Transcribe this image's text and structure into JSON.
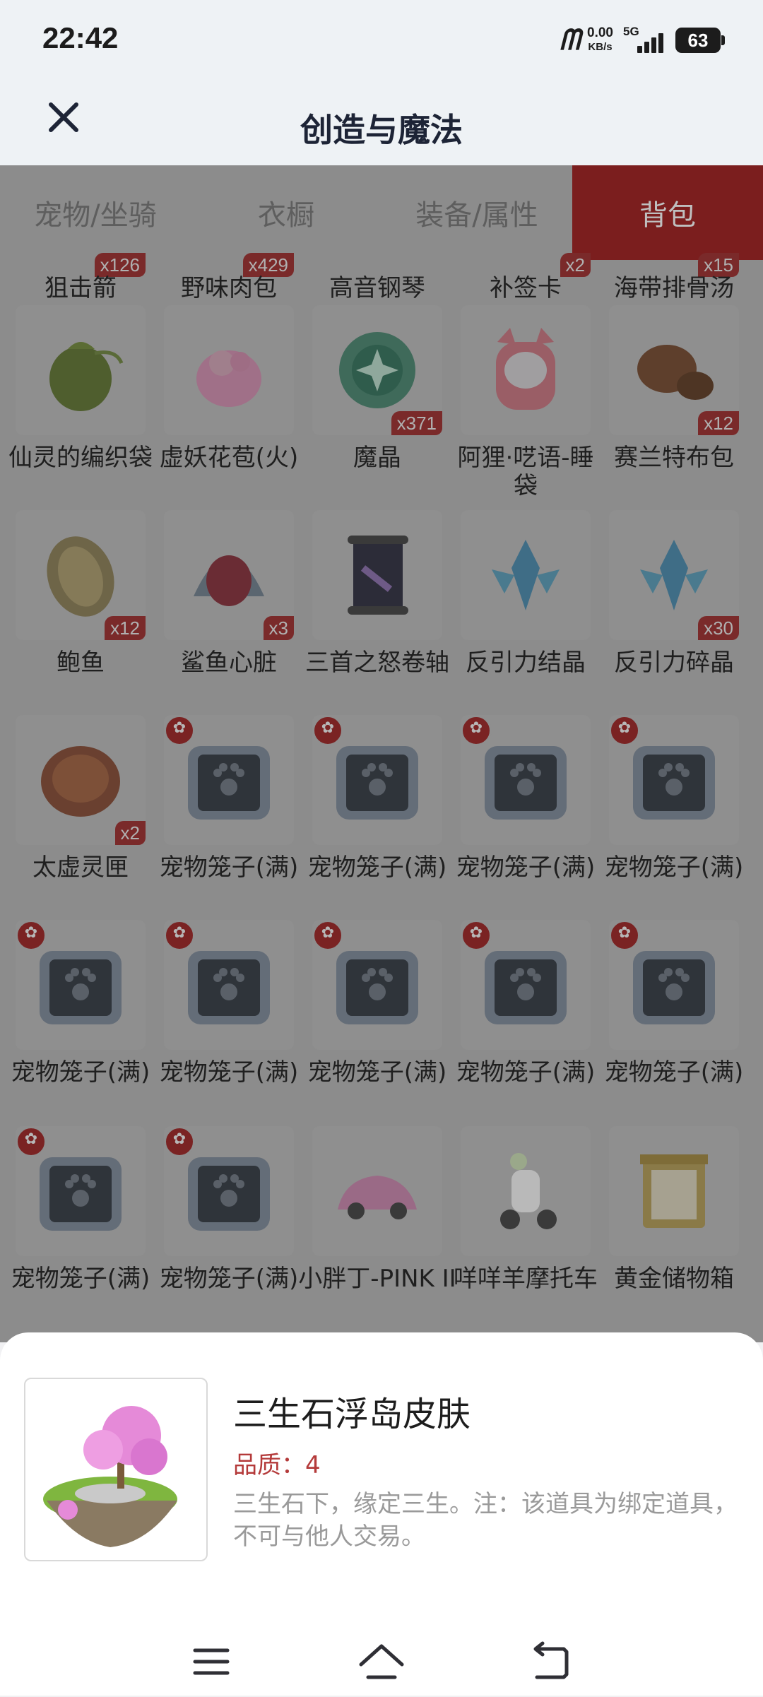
{
  "status_bar": {
    "time": "22:42",
    "net_speed_value": "0.00",
    "net_speed_unit": "KB/s",
    "network": "5G",
    "battery": "63"
  },
  "header": {
    "title": "创造与魔法",
    "close_icon": "close-icon"
  },
  "tabs": [
    {
      "label": "宠物/坐骑",
      "active": false
    },
    {
      "label": "衣橱",
      "active": false
    },
    {
      "label": "装备/属性",
      "active": false
    },
    {
      "label": "背包",
      "active": true
    }
  ],
  "inventory": {
    "partial_row": [
      {
        "name": "狙击箭",
        "count": "x126"
      },
      {
        "name": "野味肉包",
        "count": "x429"
      },
      {
        "name": "高音钢琴",
        "count": ""
      },
      {
        "name": "补签卡",
        "count": "x2"
      },
      {
        "name": "海带排骨汤",
        "count": "x15"
      }
    ],
    "rows": [
      [
        {
          "name": "仙灵的编织袋",
          "count": "",
          "icon": "green-pouch-icon"
        },
        {
          "name": "虚妖花苞(火)",
          "count": "",
          "icon": "pink-flower-bud-icon"
        },
        {
          "name": "魔晶",
          "count": "x371",
          "icon": "green-crystal-icon"
        },
        {
          "name": "阿狸·呓语-睡袋",
          "count": "",
          "icon": "fox-sleeping-bag-icon"
        },
        {
          "name": "赛兰特布包",
          "count": "x12",
          "icon": "leather-pouch-icon"
        }
      ],
      [
        {
          "name": "鲍鱼",
          "count": "x12",
          "icon": "abalone-icon"
        },
        {
          "name": "鲨鱼心脏",
          "count": "x3",
          "icon": "shark-heart-icon"
        },
        {
          "name": "三首之怒卷轴",
          "count": "",
          "icon": "scroll-icon"
        },
        {
          "name": "反引力结晶",
          "count": "",
          "icon": "antigravity-crystal-icon"
        },
        {
          "name": "反引力碎晶",
          "count": "x30",
          "icon": "antigravity-shard-icon"
        }
      ],
      [
        {
          "name": "太虚灵匣",
          "count": "x2",
          "icon": "spirit-box-icon"
        },
        {
          "name": "宠物笼子(满)",
          "count": "",
          "icon": "pet-cage-icon"
        },
        {
          "name": "宠物笼子(满)",
          "count": "",
          "icon": "pet-cage-icon"
        },
        {
          "name": "宠物笼子(满)",
          "count": "",
          "icon": "pet-cage-icon"
        },
        {
          "name": "宠物笼子(满)",
          "count": "",
          "icon": "pet-cage-icon"
        }
      ],
      [
        {
          "name": "宠物笼子(满)",
          "count": "",
          "icon": "pet-cage-icon"
        },
        {
          "name": "宠物笼子(满)",
          "count": "",
          "icon": "pet-cage-icon"
        },
        {
          "name": "宠物笼子(满)",
          "count": "",
          "icon": "pet-cage-icon"
        },
        {
          "name": "宠物笼子(满)",
          "count": "",
          "icon": "pet-cage-icon"
        },
        {
          "name": "宠物笼子(满)",
          "count": "",
          "icon": "pet-cage-icon"
        }
      ],
      [
        {
          "name": "宠物笼子(满)",
          "count": "",
          "icon": "pet-cage-icon"
        },
        {
          "name": "宠物笼子(满)",
          "count": "",
          "icon": "pet-cage-icon"
        },
        {
          "name": "小胖丁-PINK II",
          "count": "",
          "icon": "pink-car-icon"
        },
        {
          "name": "咩咩羊摩托车",
          "count": "",
          "icon": "sheep-scooter-icon"
        },
        {
          "name": "黄金储物箱",
          "count": "",
          "icon": "gold-storage-box-icon"
        }
      ]
    ]
  },
  "detail": {
    "name": "三生石浮岛皮肤",
    "quality": "品质：4",
    "description": "三生石下，缘定三生。注：该道具为绑定道具，不可与他人交易。",
    "icon": "floating-island-icon"
  },
  "nav": {
    "menu_icon": "menu-icon",
    "home_icon": "home-icon",
    "back_icon": "back-icon"
  }
}
